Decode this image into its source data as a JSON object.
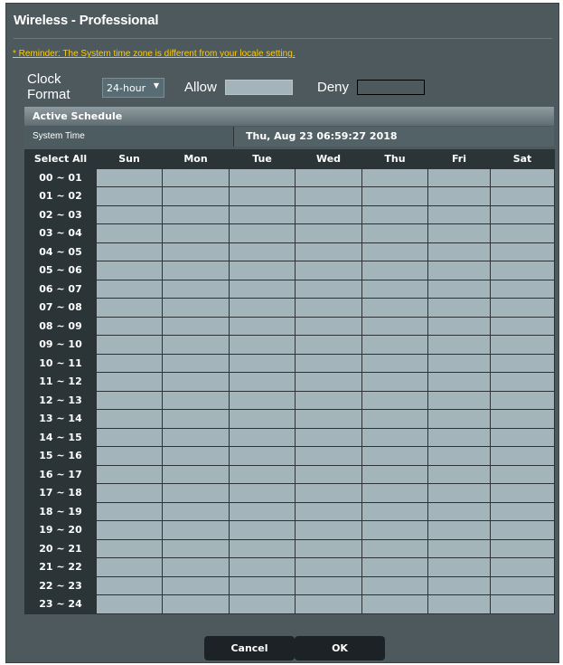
{
  "page": {
    "title": "Wireless - Professional",
    "reminder": "* Reminder: The System time zone is different from your locale setting."
  },
  "clock": {
    "label": "Clock Format",
    "selected": "24-hour"
  },
  "legend": {
    "allow_label": "Allow",
    "deny_label": "Deny",
    "allow_color": "#a3b4bb",
    "deny_color": "#4d595d"
  },
  "schedule": {
    "header": "Active Schedule",
    "system_time_label": "System Time",
    "system_time_value": "Thu, Aug 23 06:59:27 2018",
    "select_all": "Select All",
    "days": [
      "Sun",
      "Mon",
      "Tue",
      "Wed",
      "Thu",
      "Fri",
      "Sat"
    ],
    "hours": [
      "00 ~ 01",
      "01 ~ 02",
      "02 ~ 03",
      "03 ~ 04",
      "04 ~ 05",
      "05 ~ 06",
      "06 ~ 07",
      "07 ~ 08",
      "08 ~ 09",
      "09 ~ 10",
      "10 ~ 11",
      "11 ~ 12",
      "12 ~ 13",
      "13 ~ 14",
      "14 ~ 15",
      "15 ~ 16",
      "16 ~ 17",
      "17 ~ 18",
      "18 ~ 19",
      "19 ~ 20",
      "20 ~ 21",
      "21 ~ 22",
      "22 ~ 23",
      "23 ~ 24"
    ],
    "cell_state": "allow"
  },
  "buttons": {
    "cancel": "Cancel",
    "ok": "OK"
  }
}
